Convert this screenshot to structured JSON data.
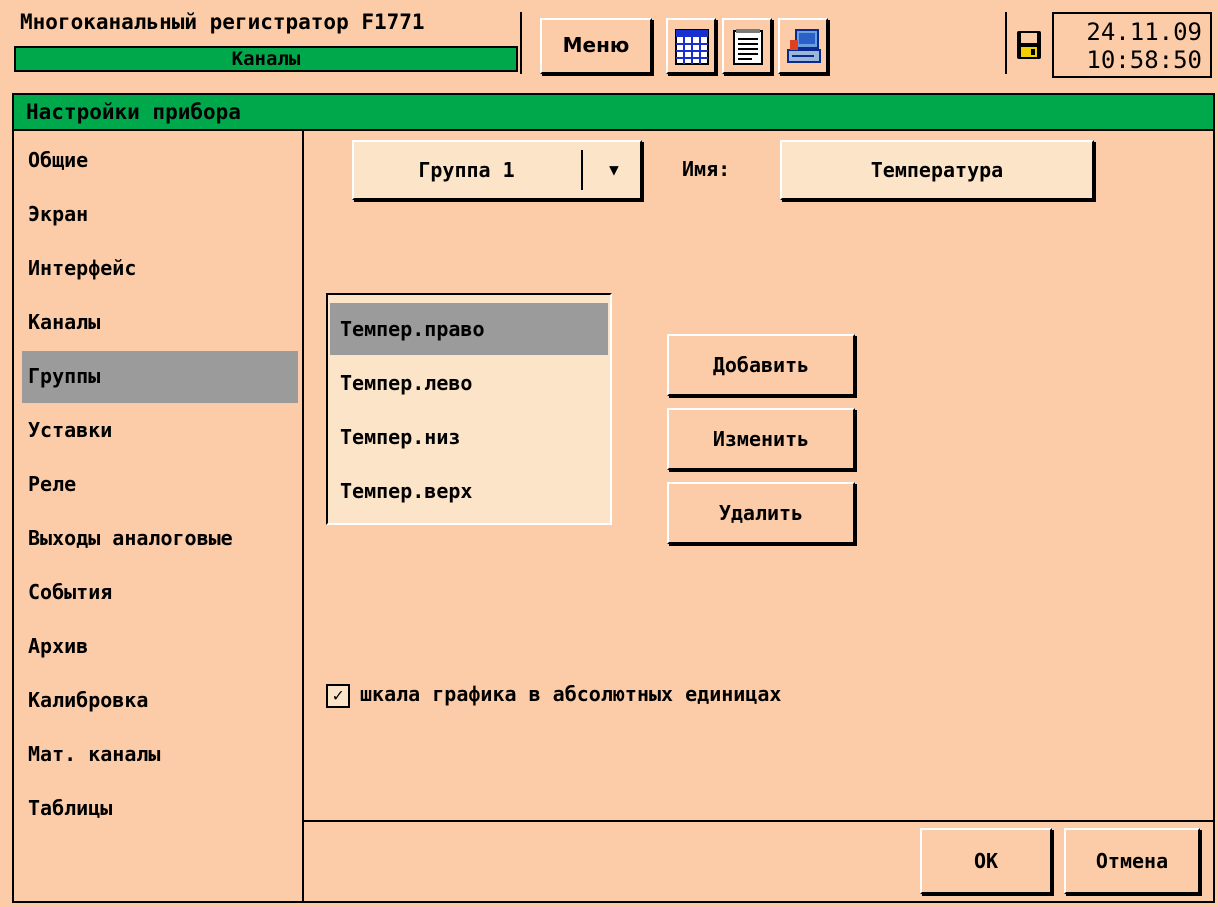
{
  "header": {
    "app_title": "Многоканальный регистратор F1771",
    "mode": "Каналы",
    "menu_label": "Меню",
    "date": "24.11.09",
    "time": "10:58:50",
    "icons": [
      "table-icon",
      "notepad-icon",
      "computer-icon",
      "save-disk-icon"
    ]
  },
  "dialog": {
    "title": "Настройки прибора",
    "sidebar": {
      "items": [
        {
          "label": "Общие",
          "active": false
        },
        {
          "label": "Экран",
          "active": false
        },
        {
          "label": "Интерфейс",
          "active": false
        },
        {
          "label": "Каналы",
          "active": false
        },
        {
          "label": "Группы",
          "active": true
        },
        {
          "label": "Уставки",
          "active": false
        },
        {
          "label": "Реле",
          "active": false
        },
        {
          "label": "Выходы аналоговые",
          "active": false
        },
        {
          "label": "События",
          "active": false
        },
        {
          "label": "Архив",
          "active": false
        },
        {
          "label": "Калибровка",
          "active": false
        },
        {
          "label": "Мат. каналы",
          "active": false
        },
        {
          "label": "Таблицы",
          "active": false
        }
      ]
    },
    "group_select": {
      "value": "Группа 1",
      "arrow": "▼"
    },
    "name_label": "Имя:",
    "name_value": "Температура",
    "channels": [
      {
        "label": "Темпер.право",
        "selected": true
      },
      {
        "label": "Темпер.лево",
        "selected": false
      },
      {
        "label": "Темпер.низ",
        "selected": false
      },
      {
        "label": "Темпер.верх",
        "selected": false
      }
    ],
    "buttons": {
      "add": "Добавить",
      "edit": "Изменить",
      "delete": "Удалить"
    },
    "checkbox": {
      "checked": true,
      "mark": "✓",
      "label": "шкала графика в абсолютных единицах"
    },
    "footer": {
      "ok": "OK",
      "cancel": "Отмена"
    }
  },
  "colors": {
    "background": "#fccca8",
    "title_bar": "#00a84c",
    "selection": "#9b9b9b",
    "field": "#fce4c8"
  }
}
